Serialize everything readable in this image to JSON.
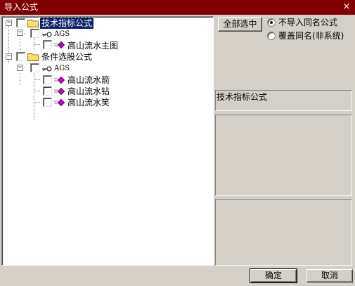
{
  "window": {
    "title": "导入公式",
    "close_glyph": "×"
  },
  "tree": {
    "groups": [
      {
        "label": "技术指标公式",
        "expander": "−",
        "selected": true,
        "subgroups": [
          {
            "label": "AGS",
            "expander": "−",
            "items": [
              "高山流水主图"
            ]
          }
        ]
      },
      {
        "label": "条件选股公式",
        "expander": "−",
        "selected": false,
        "subgroups": [
          {
            "label": "AGS",
            "expander": "−",
            "items": [
              "高山流水箭",
              "高山流水钻",
              "高山流水笑"
            ]
          }
        ]
      }
    ]
  },
  "options": {
    "select_all_label": "全部选中",
    "radio_options": [
      {
        "label": "不导入同名公式",
        "checked": true
      },
      {
        "label": "覆盖同名(非系统)",
        "checked": false
      }
    ]
  },
  "info": {
    "label": "技术指标公式"
  },
  "footer": {
    "ok_label": "确定",
    "cancel_label": "取消"
  },
  "colors": {
    "titlebar": "#800000",
    "selection": "#0a246a",
    "dialog_bg": "#d4d0c8",
    "formula_icon": "#cc00cc"
  },
  "icons": {
    "group": "folder-icon",
    "subgroup": "key-icon",
    "item": "formula-icon"
  }
}
